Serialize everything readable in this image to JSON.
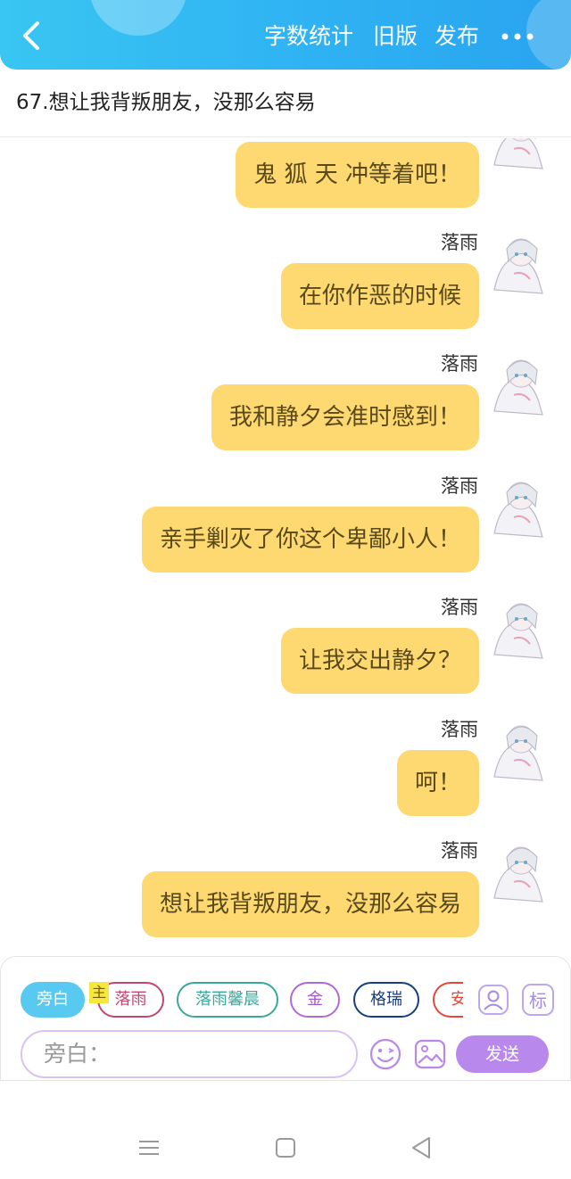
{
  "header": {
    "back_icon": "chevron-left-icon",
    "actions": [
      "字数统计",
      "旧版",
      "发布"
    ],
    "more_icon": "more-dots-icon"
  },
  "chapter_title": "67.想让我背叛朋友，没那么容易",
  "messages": [
    {
      "speaker": "",
      "text": "鬼 狐 天 冲等着吧！"
    },
    {
      "speaker": "落雨",
      "text": "在你作恶的时候"
    },
    {
      "speaker": "落雨",
      "text": "我和静夕会准时感到！"
    },
    {
      "speaker": "落雨",
      "text": "亲手剿灭了你这个卑鄙小人！"
    },
    {
      "speaker": "落雨",
      "text": "让我交出静夕？"
    },
    {
      "speaker": "落雨",
      "text": "呵！"
    },
    {
      "speaker": "落雨",
      "text": "想让我背叛朋友，没那么容易"
    }
  ],
  "composer": {
    "chips": [
      "旁白",
      "落雨",
      "落雨馨晨",
      "金",
      "格瑞",
      "安"
    ],
    "main_tag": "主",
    "role_icon": "role-avatar-icon",
    "mark_label": "标",
    "input_placeholder": "旁白：",
    "emoji_icon": "emoji-icon",
    "image_icon": "image-icon",
    "send_label": "发送"
  },
  "navbar": [
    "menu-icon",
    "home-icon",
    "back-icon"
  ],
  "colors": {
    "header": "#2fb2f3",
    "bubble": "#fed972",
    "bubble_text": "#5a4a1a",
    "send": "#b988ed",
    "chip_narration": "#58c9f1"
  }
}
